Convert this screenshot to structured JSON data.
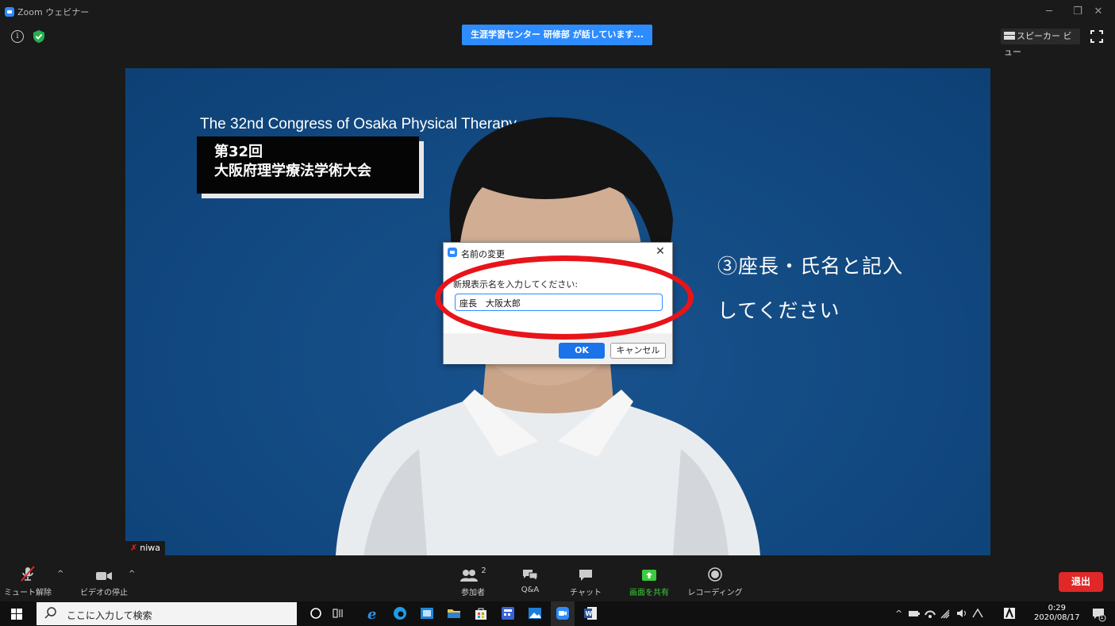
{
  "window": {
    "title": "Zoom ウェビナー",
    "controls": [
      "─",
      "❐",
      "✕"
    ]
  },
  "top_bar": {
    "talking_banner": "生涯学習センター 研修部 が話しています...",
    "speaker_view_label": "スピーカー ビュー",
    "info_glyph": "i"
  },
  "video": {
    "congress_en": "The 32nd Congress of Osaka Physical Therapy",
    "congress_jp_line1": "第32回",
    "congress_jp_line2": "大阪府理学療法学術大会",
    "annotation_line1": "③座長・氏名と記入",
    "annotation_line2": "してください",
    "participant_name": "niwa",
    "muted_glyph": "✗"
  },
  "dialog": {
    "title": "名前の変更",
    "close": "✕",
    "prompt": "新規表示名を入力してください:",
    "input_value": "座長　大阪太郎",
    "ok_label": "OK",
    "cancel_label": "キャンセル"
  },
  "toolbar": {
    "unmute_label": "ミュート解除",
    "stop_video_label": "ビデオの停止",
    "participants_label": "参加者",
    "participants_count": "2",
    "qa_label": "Q&A",
    "chat_label": "チャット",
    "share_label": "画面を共有",
    "recording_label": "レコーディング",
    "exit_label": "退出",
    "caret": "^"
  },
  "taskbar": {
    "search_placeholder": "ここに入力して検索",
    "time": "0:29",
    "date": "2020/08/17",
    "notification_count": "1"
  },
  "colors": {
    "zoom_blue": "#2d8cff",
    "slide_blue": "#0f4c8a",
    "exit_red": "#e02828",
    "share_green": "#3ccb3c",
    "annotation_red": "#e8141a"
  }
}
